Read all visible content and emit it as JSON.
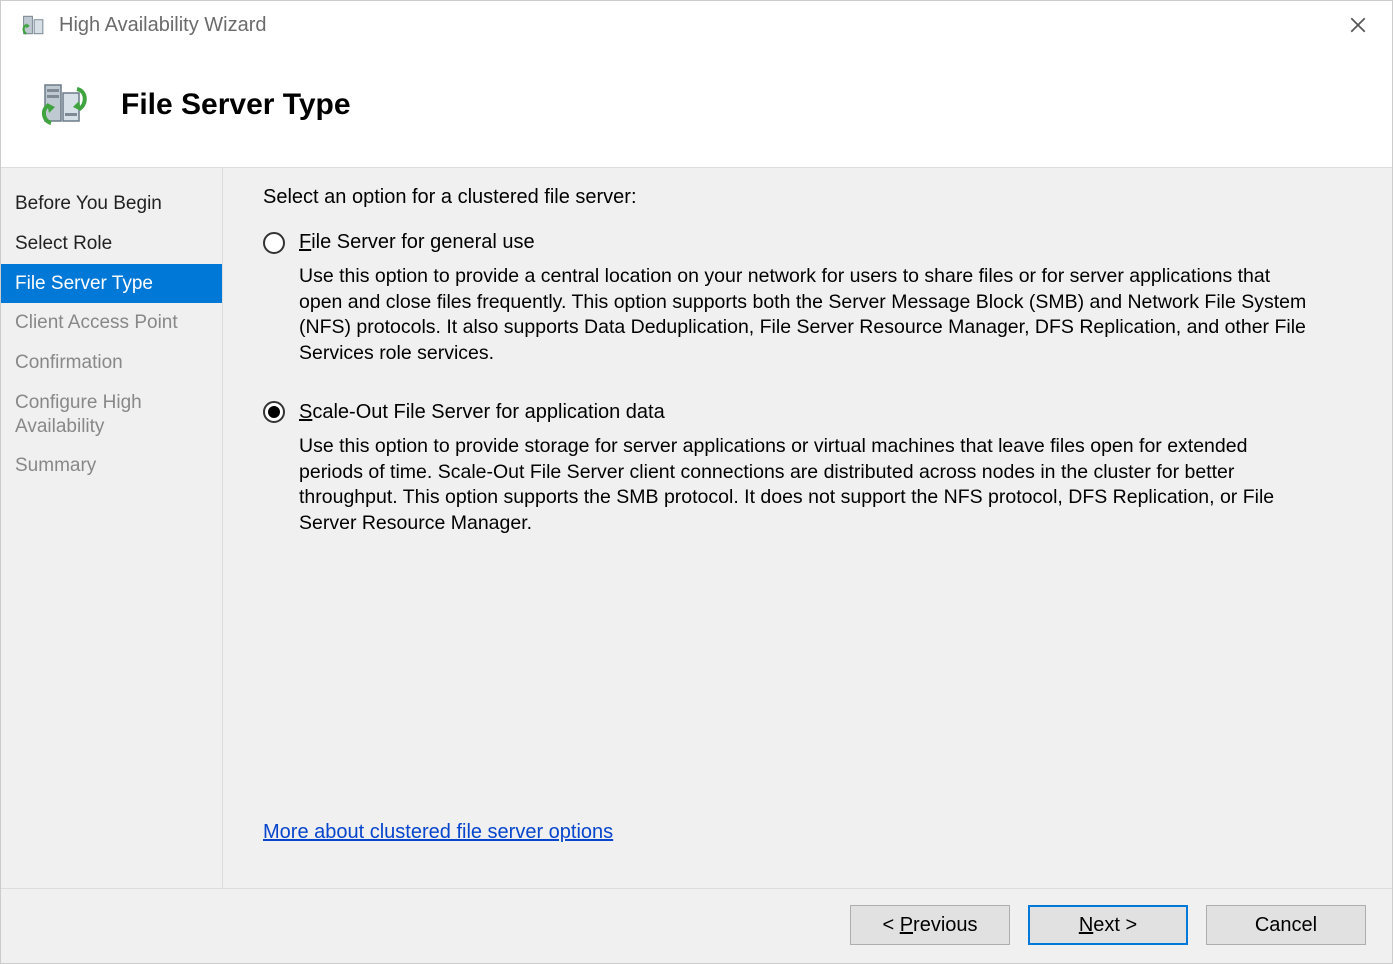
{
  "window": {
    "title": "High Availability Wizard"
  },
  "header": {
    "title": "File Server Type"
  },
  "sidebar": {
    "items": [
      {
        "label": "Before You Begin",
        "state": "completed"
      },
      {
        "label": "Select Role",
        "state": "completed"
      },
      {
        "label": "File Server Type",
        "state": "selected"
      },
      {
        "label": "Client Access Point",
        "state": "pending"
      },
      {
        "label": "Confirmation",
        "state": "pending"
      },
      {
        "label": "Configure High Availability",
        "state": "pending"
      },
      {
        "label": "Summary",
        "state": "pending"
      }
    ]
  },
  "main": {
    "prompt": "Select an option for a clustered file server:",
    "options": [
      {
        "id": "general",
        "label_prefix": "F",
        "label_rest": "ile Server for general use",
        "selected": false,
        "description": "Use this option to provide a central location on your network for users to share files or for server applications that open and close files frequently. This option supports both the Server Message Block (SMB) and Network File System (NFS) protocols. It also supports Data Deduplication, File Server Resource Manager, DFS Replication, and other File Services role services."
      },
      {
        "id": "scaleout",
        "label_prefix": "S",
        "label_rest": "cale-Out File Server for application data",
        "selected": true,
        "description": "Use this option to provide storage for server applications or virtual machines that leave files open for extended periods of time. Scale-Out File Server client connections are distributed across nodes in the cluster for better throughput. This option supports the SMB protocol. It does not support the NFS protocol, DFS Replication, or File Server Resource Manager."
      }
    ],
    "help_link": "More about clustered file server options"
  },
  "buttons": {
    "previous_ul": "P",
    "previous_rest": "revious",
    "previous_prefix": "< ",
    "next_ul": "N",
    "next_rest": "ext >",
    "cancel": "Cancel"
  }
}
